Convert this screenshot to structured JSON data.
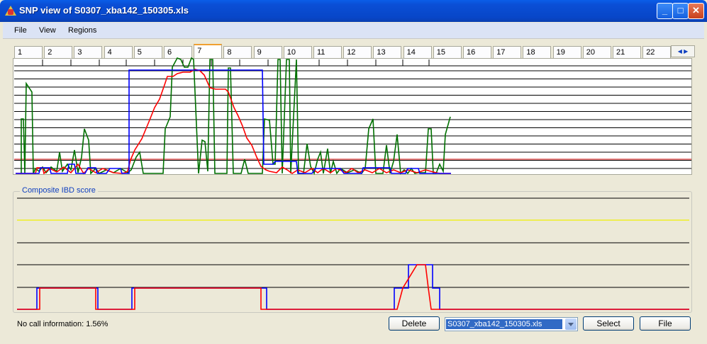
{
  "window": {
    "title": "SNP view of S0307_xba142_150305.xls"
  },
  "menu": [
    "File",
    "View",
    "Regions"
  ],
  "tabs": [
    "1",
    "2",
    "3",
    "4",
    "5",
    "6",
    "7",
    "8",
    "9",
    "10",
    "11",
    "12",
    "13",
    "14",
    "15",
    "16",
    "17",
    "18",
    "19",
    "20",
    "21",
    "22"
  ],
  "active_tab": "7",
  "composite_label": "Composite IBD score",
  "status_text": "No call information: 1.56%",
  "buttons": {
    "delete": "Delete",
    "select": "Select",
    "file": "File"
  },
  "file_select": {
    "value": "S0307_xba142_150305.xls"
  },
  "colors": {
    "green": "#007000",
    "red": "#ff0000",
    "blue": "#0000ff",
    "yellow": "#f0f000"
  },
  "chart_data": [
    {
      "type": "line",
      "title": "",
      "series": [
        {
          "values": []
        }
      ]
    },
    {
      "type": "line",
      "title": "Composite IBD score",
      "series": [
        {
          "values": []
        }
      ]
    }
  ]
}
